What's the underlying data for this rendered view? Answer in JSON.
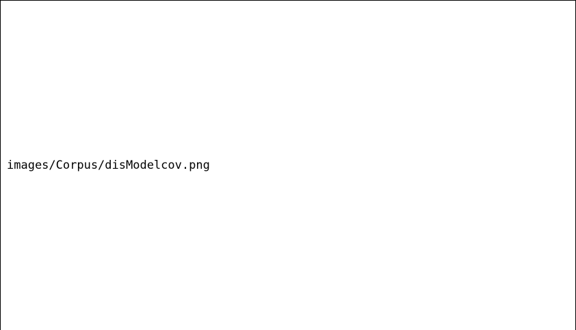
{
  "placeholder": {
    "image_path_text": "images/Corpus/disModelcov.png"
  },
  "colors": {
    "border": "#000000",
    "background": "#ffffff",
    "text": "#000000"
  }
}
